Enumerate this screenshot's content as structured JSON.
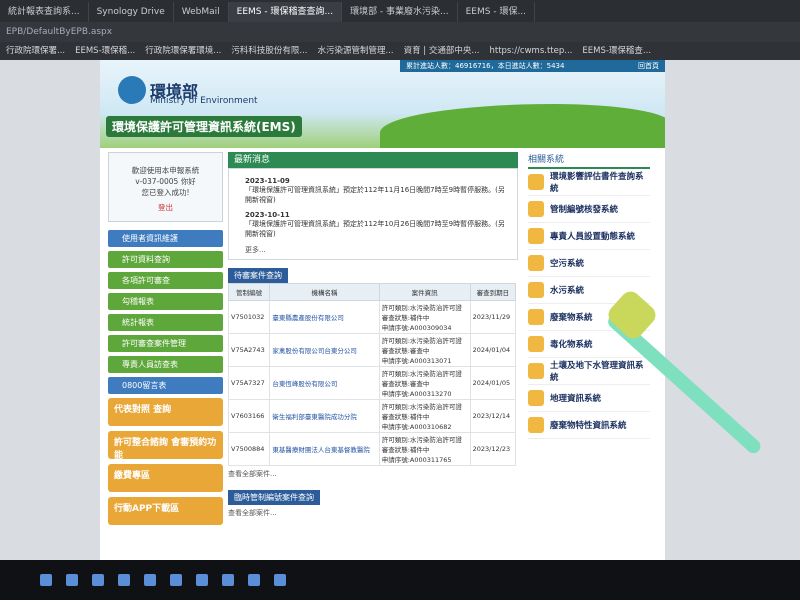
{
  "browser": {
    "tabs": [
      "統計報表查詢系...",
      "Synology Drive",
      "WebMail",
      "EEMS - 環保稽查查詢...",
      "環境部 - 事業廢水污染...",
      "EEMS - 環保..."
    ],
    "url": "EPB/DefaultByEPB.aspx",
    "bookmarks": [
      "行政院環保署...",
      "EEMS-環保稽...",
      "行政院環保署環境...",
      "污科科技股份有限...",
      "水污染源管制管理...",
      "資育 | 交通部中央...",
      "https://cwms.ttep...",
      "EEMS-環保稽查..."
    ]
  },
  "site": {
    "topbar": {
      "visitors": "累計進站人數：46916716，本日進站人數：5434",
      "home": "回首頁"
    },
    "logo_cn": "環境部",
    "logo_en": "Ministry of Environment",
    "system_title": "環境保護許可管理資訊系統(EMS)",
    "login": {
      "lines": [
        "歡迎使用本申報系統",
        "v-037-0005 你好",
        "您已登入成功!"
      ],
      "logout": "登出"
    },
    "menu": [
      "使用者資訊維護",
      "許可資料查詢",
      "各項許可審查",
      "勾稽報表",
      "統計報表",
      "許可審查案件管理",
      "專責人員訪查表",
      "0800留言表"
    ],
    "promos": [
      "代表對照 查詢",
      "許可整合諮詢 會審預約功能",
      "繳費專區",
      "行動APP下載區"
    ],
    "news": {
      "title": "最新消息",
      "items": [
        {
          "date": "2023-11-09",
          "text": "「環境保護許可管理資訊系統」預定於112年11月16日晚間7時至9時暫停服務。(另開新視窗)"
        },
        {
          "date": "2023-10-11",
          "text": "「環境保護許可管理資訊系統」預定於112年10月26日晚間7時至9時暫停服務。(另開新視窗)"
        }
      ],
      "more": "更多..."
    },
    "pending": {
      "title": "待審案件查詢",
      "headers": [
        "管制編號",
        "機構名稱",
        "案件資訊",
        "審查到期日"
      ],
      "rows": [
        {
          "id": "V7501032",
          "name": "臺東縣農產股份有限公司",
          "info": [
            "許可類別:水污染防治許可證",
            "審查狀態:補件中",
            "申請序號:A000309034"
          ],
          "due": "2023/11/29"
        },
        {
          "id": "V75A2743",
          "name": "家禽股份有限公司台東分公司",
          "info": [
            "許可類別:水污染防治許可證",
            "審查狀態:審查中",
            "申請序號:A000313071"
          ],
          "due": "2024/01/04"
        },
        {
          "id": "V75A7327",
          "name": "台東恆峰股份有限公司",
          "info": [
            "許可類別:水污染防治許可證",
            "審查狀態:審查中",
            "申請序號:A000313270"
          ],
          "due": "2024/01/05"
        },
        {
          "id": "V7603166",
          "name": "衛生福利部臺東醫院成功分院",
          "info": [
            "許可類別:水污染防治許可證",
            "審查狀態:補件中",
            "申請序號:A000310682"
          ],
          "due": "2023/12/14"
        },
        {
          "id": "V7500884",
          "name": "東基醫療財團法人台東基督教醫院",
          "info": [
            "許可類別:水污染防治許可證",
            "審查狀態:補件中",
            "申請序號:A000311765"
          ],
          "due": "2023/12/23"
        }
      ],
      "view_all": "查看全部案件..."
    },
    "temp": {
      "title": "臨時管制編號案件查詢",
      "view_all": "查看全部案件..."
    },
    "related": {
      "title": "相關系統",
      "items": [
        "環境影響評估書件查詢系統",
        "管制編號核發系統",
        "專責人員設置動態系統",
        "空污系統",
        "水污系統",
        "廢棄物系統",
        "毒化物系統",
        "土壤及地下水管理資訊系統",
        "地理資訊系統",
        "廢棄物特性資訊系統"
      ]
    }
  }
}
